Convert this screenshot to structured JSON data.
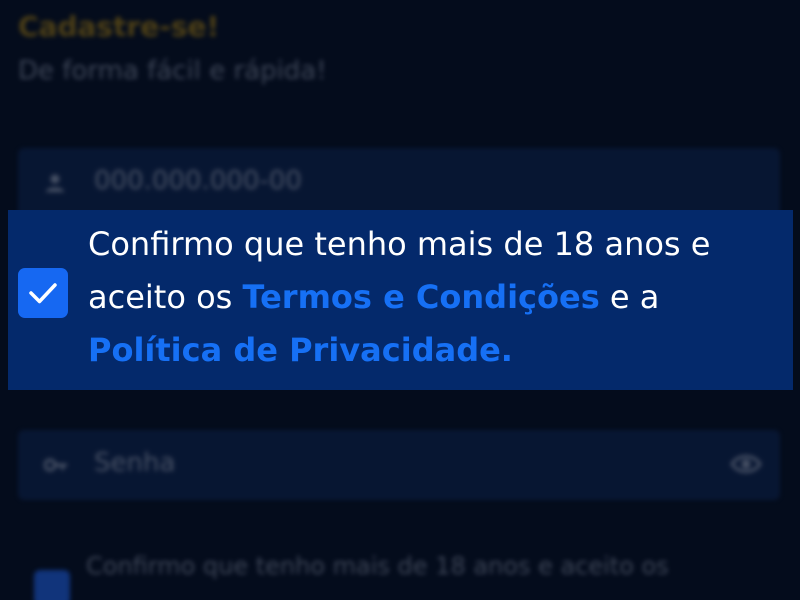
{
  "header": {
    "title": "Cadastre-se!",
    "subtitle": "De forma fácil e rápida!"
  },
  "form": {
    "cpf_placeholder": "000.000.000-00",
    "password_placeholder": "Senha",
    "consent_background_text": "Confirmo que tenho mais de 18 anos e aceito os"
  },
  "consent": {
    "checked": true,
    "text_part1": "Confirmo que tenho mais de 18 anos e aceito os ",
    "terms_link": "Termos e Condições",
    "text_part2": " e a ",
    "privacy_link": "Política de Privacidade."
  },
  "colors": {
    "background": "#040c1c",
    "panel": "#04296b",
    "accent": "#1668f2",
    "link": "#1670f5",
    "title": "#8a6a12"
  },
  "icons": {
    "user": "user-icon",
    "key": "key-icon",
    "eye": "eye-icon",
    "check": "checkmark-icon"
  }
}
